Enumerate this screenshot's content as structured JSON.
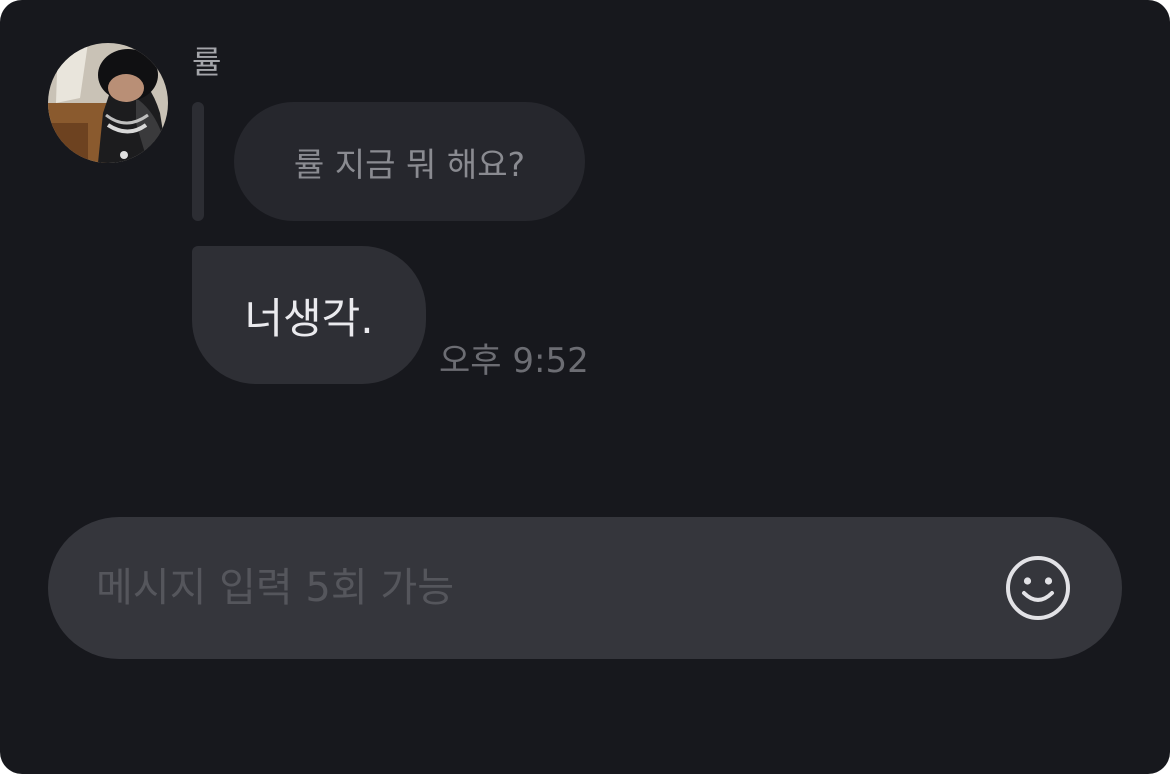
{
  "chat": {
    "sender_name": "률",
    "quoted_message": "률 지금 뭐 해요?",
    "message_text": "너생각.",
    "timestamp": "오후 9:52"
  },
  "composer": {
    "placeholder": "메시지 입력 5회 가능",
    "emoji_icon": "smiley-face-icon"
  },
  "colors": {
    "background": "#17181d",
    "bubble": "#2e2f35",
    "input_bar": "#35363c"
  }
}
